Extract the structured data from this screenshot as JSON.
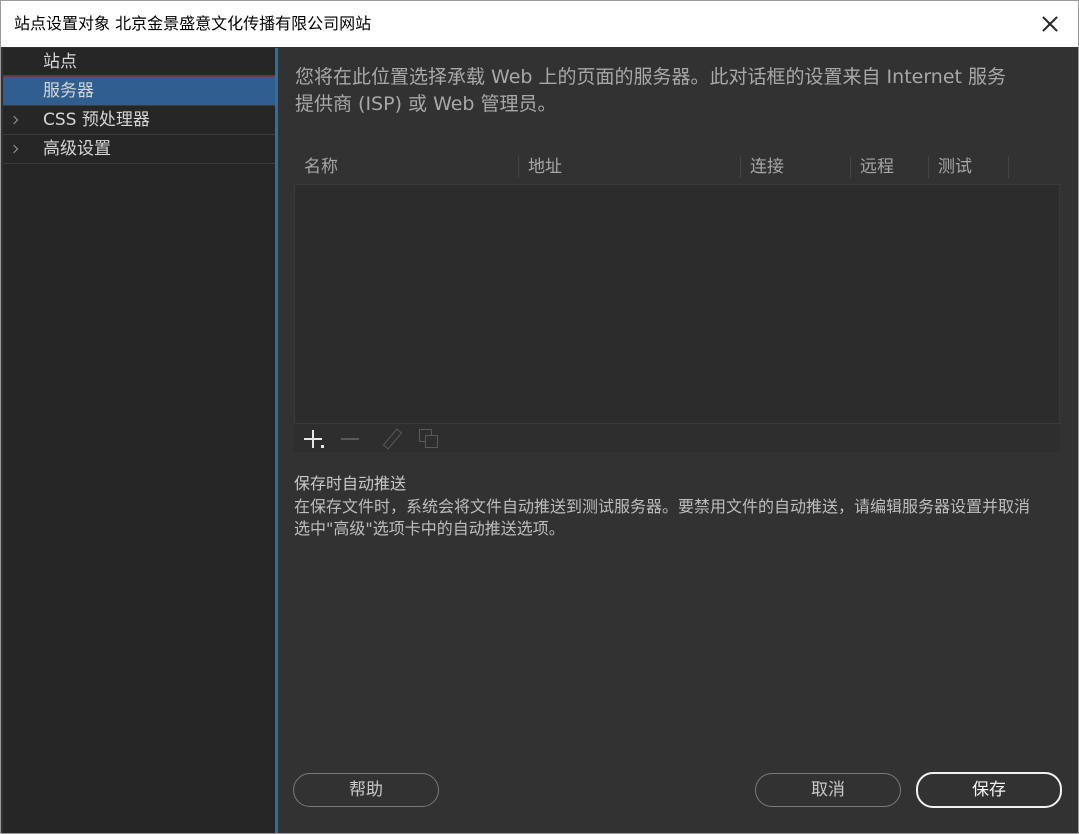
{
  "window": {
    "title": "站点设置对象 北京金景盛意文化传播有限公司网站"
  },
  "sidebar": {
    "items": [
      {
        "label": "站点"
      },
      {
        "label": "服务器"
      },
      {
        "label": "CSS 预处理器"
      },
      {
        "label": "高级设置"
      }
    ]
  },
  "main": {
    "intro": "您将在此位置选择承载 Web 上的页面的服务器。此对话框的设置来自 Internet 服务提供商 (ISP) 或 Web 管理员。",
    "table": {
      "columns": [
        "名称",
        "地址",
        "连接",
        "远程",
        "测试"
      ]
    },
    "autopush": {
      "title": "保存时自动推送",
      "description": "在保存文件时，系统会将文件自动推送到测试服务器。要禁用文件的自动推送，请编辑服务器设置并取消选中\"高级\"选项卡中的自动推送选项。"
    }
  },
  "buttons": {
    "help": "帮助",
    "cancel": "取消",
    "save": "保存"
  },
  "colors": {
    "accent": "#2f5e8f",
    "background": "#323232",
    "sidebar": "#262626"
  }
}
